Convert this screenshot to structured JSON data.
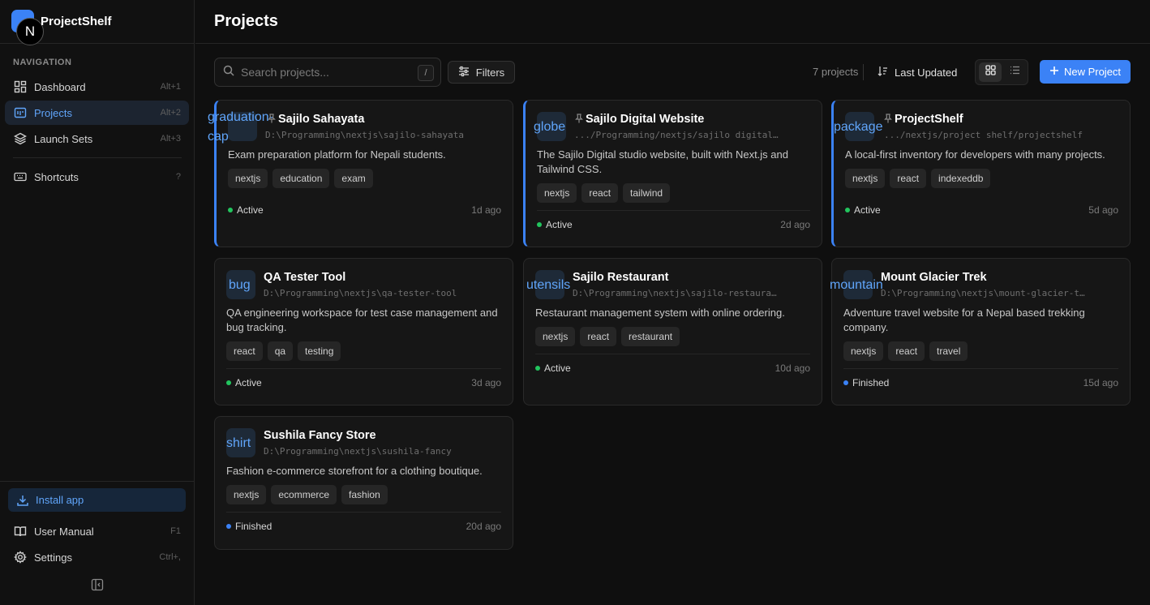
{
  "app": {
    "name": "ProjectShelf",
    "avatar_letter": "N"
  },
  "sidebar": {
    "heading": "NAVIGATION",
    "items": [
      {
        "label": "Dashboard",
        "shortcut": "Alt+1",
        "icon": "dashboard-icon",
        "active": false
      },
      {
        "label": "Projects",
        "shortcut": "Alt+2",
        "icon": "projects-icon",
        "active": true
      },
      {
        "label": "Launch Sets",
        "shortcut": "Alt+3",
        "icon": "layers-icon",
        "active": false
      }
    ],
    "shortcuts": {
      "label": "Shortcuts",
      "key": "?"
    },
    "install": "Install app",
    "manual": {
      "label": "User Manual",
      "key": "F1"
    },
    "settings": {
      "label": "Settings",
      "key": "Ctrl+,"
    }
  },
  "header": {
    "title": "Projects"
  },
  "toolbar": {
    "search_placeholder": "Search projects...",
    "search_key": "/",
    "filters": "Filters",
    "count": "7 projects",
    "sort": "Last Updated",
    "new_project": "New Project"
  },
  "colors": {
    "accent": "#3b82f6",
    "active": "#22c55e",
    "finished": "#3b82f6"
  },
  "projects": [
    {
      "icon": "graduation-cap",
      "title": "Sajilo Sahayata",
      "path": "D:\\Programming\\nextjs\\sajilo-sahayata",
      "desc": "Exam preparation platform for Nepali students.",
      "tags": [
        "nextjs",
        "education",
        "exam"
      ],
      "status": "Active",
      "ago": "1d ago",
      "pinned": true
    },
    {
      "icon": "globe",
      "title": "Sajilo Digital Website",
      "path": ".../Programming/nextjs/sajilo digital…",
      "desc": "The Sajilo Digital studio website, built with Next.js and Tailwind CSS.",
      "tags": [
        "nextjs",
        "react",
        "tailwind"
      ],
      "status": "Active",
      "ago": "2d ago",
      "pinned": true
    },
    {
      "icon": "package",
      "title": "ProjectShelf",
      "path": ".../nextjs/project shelf/projectshelf",
      "desc": "A local-first inventory for developers with many projects.",
      "tags": [
        "nextjs",
        "react",
        "indexeddb"
      ],
      "status": "Active",
      "ago": "5d ago",
      "pinned": true
    },
    {
      "icon": "bug",
      "title": "QA Tester Tool",
      "path": "D:\\Programming\\nextjs\\qa-tester-tool",
      "desc": "QA engineering workspace for test case management and bug tracking.",
      "tags": [
        "react",
        "qa",
        "testing"
      ],
      "status": "Active",
      "ago": "3d ago",
      "pinned": false
    },
    {
      "icon": "utensils",
      "title": "Sajilo Restaurant",
      "path": "D:\\Programming\\nextjs\\sajilo-restaura…",
      "desc": "Restaurant management system with online ordering.",
      "tags": [
        "nextjs",
        "react",
        "restaurant"
      ],
      "status": "Active",
      "ago": "10d ago",
      "pinned": false
    },
    {
      "icon": "mountain",
      "title": "Mount Glacier Trek",
      "path": "D:\\Programming\\nextjs\\mount-glacier-t…",
      "desc": "Adventure travel website for a Nepal based trekking company.",
      "tags": [
        "nextjs",
        "react",
        "travel"
      ],
      "status": "Finished",
      "ago": "15d ago",
      "pinned": false
    },
    {
      "icon": "shirt",
      "title": "Sushila Fancy Store",
      "path": "D:\\Programming\\nextjs\\sushila-fancy",
      "desc": "Fashion e-commerce storefront for a clothing boutique.",
      "tags": [
        "nextjs",
        "ecommerce",
        "fashion"
      ],
      "status": "Finished",
      "ago": "20d ago",
      "pinned": false
    }
  ]
}
